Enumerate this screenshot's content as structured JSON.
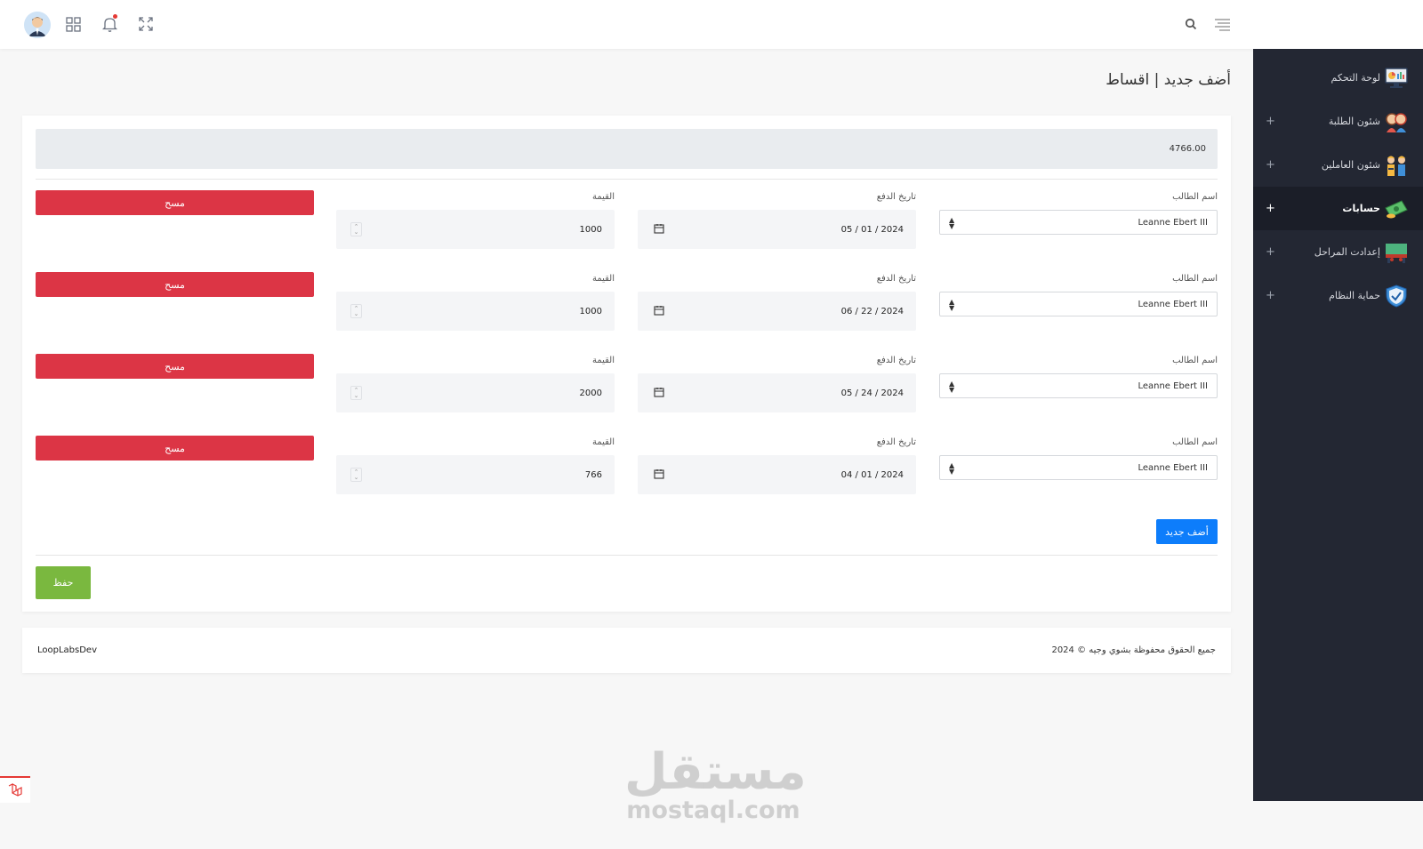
{
  "page": {
    "title": "أضف جديد | اقساط"
  },
  "topbar": {
    "avatar_icon": "user-avatar",
    "apps_icon": "grid-icon",
    "bell_icon": "bell-icon",
    "expand_icon": "expand-icon",
    "search_icon": "search-icon",
    "menu_icon": "hamburger-icon"
  },
  "sidebar": {
    "items": [
      {
        "label": "لوحة التحكم",
        "icon": "dashboard-icon",
        "expandable": false,
        "active": false
      },
      {
        "label": "شئون الطلبة",
        "icon": "students-icon",
        "expandable": true,
        "active": false
      },
      {
        "label": "شئون العاملين",
        "icon": "workers-icon",
        "expandable": true,
        "active": false
      },
      {
        "label": "حسابات",
        "icon": "money-icon",
        "expandable": true,
        "active": true
      },
      {
        "label": "إعدادت المراحل",
        "icon": "stages-icon",
        "expandable": true,
        "active": false
      },
      {
        "label": "حماية النظام",
        "icon": "shield-icon",
        "expandable": true,
        "active": false
      }
    ],
    "plus": "+"
  },
  "form": {
    "total": "4766.00",
    "labels": {
      "student": "اسم الطالب",
      "date": "تاريخ الدفع",
      "amount": "القيمة",
      "delete": "مسح"
    },
    "rows": [
      {
        "student": "Leanne Ebert III",
        "date": "05 / 01 / 2024",
        "amount": "1000"
      },
      {
        "student": "Leanne Ebert III",
        "date": "06 / 22 / 2024",
        "amount": "1000"
      },
      {
        "student": "Leanne Ebert III",
        "date": "05 / 24 / 2024",
        "amount": "2000"
      },
      {
        "student": "Leanne Ebert III",
        "date": "04 / 01 / 2024",
        "amount": "766"
      }
    ],
    "add_label": "أضف جديد",
    "save_label": "حفظ"
  },
  "footer": {
    "left": "LoopLabsDev",
    "right": "جميع الحقوق محفوظة بشوي وجيه © 2024"
  },
  "watermark": {
    "arabic": "مستقل",
    "latin": "mostaql.com"
  },
  "colors": {
    "danger": "#dc3545",
    "primary": "#0d7dfb",
    "success": "#7ab83f",
    "sidebar": "#232733"
  }
}
